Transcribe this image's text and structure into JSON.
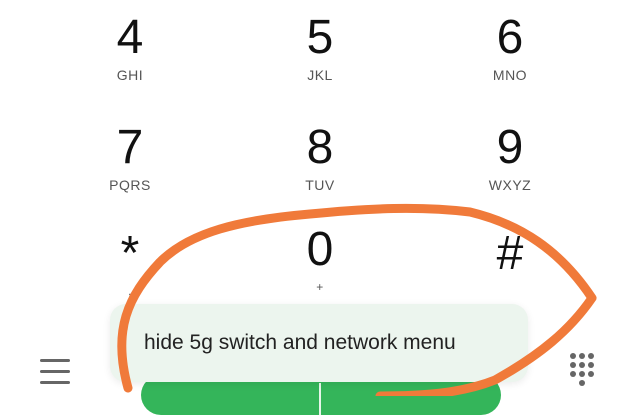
{
  "keypad": {
    "keys": [
      {
        "digit": "4",
        "letters": "GHI"
      },
      {
        "digit": "5",
        "letters": "JKL"
      },
      {
        "digit": "6",
        "letters": "MNO"
      },
      {
        "digit": "7",
        "letters": "PQRS"
      },
      {
        "digit": "8",
        "letters": "TUV"
      },
      {
        "digit": "9",
        "letters": "WXYZ"
      },
      {
        "digit": "*",
        "letters": ","
      },
      {
        "digit": "0",
        "letters": "+"
      },
      {
        "digit": "#",
        "letters": ""
      }
    ]
  },
  "tooltip": {
    "text": "hide 5g switch and network menu"
  },
  "icons": {
    "menu": "menu-icon",
    "keypad": "dialpad-icon"
  },
  "colors": {
    "call_button": "#34b55a",
    "annotation_stroke": "#f07a3a",
    "tooltip_bg": "#ecf5ee"
  }
}
